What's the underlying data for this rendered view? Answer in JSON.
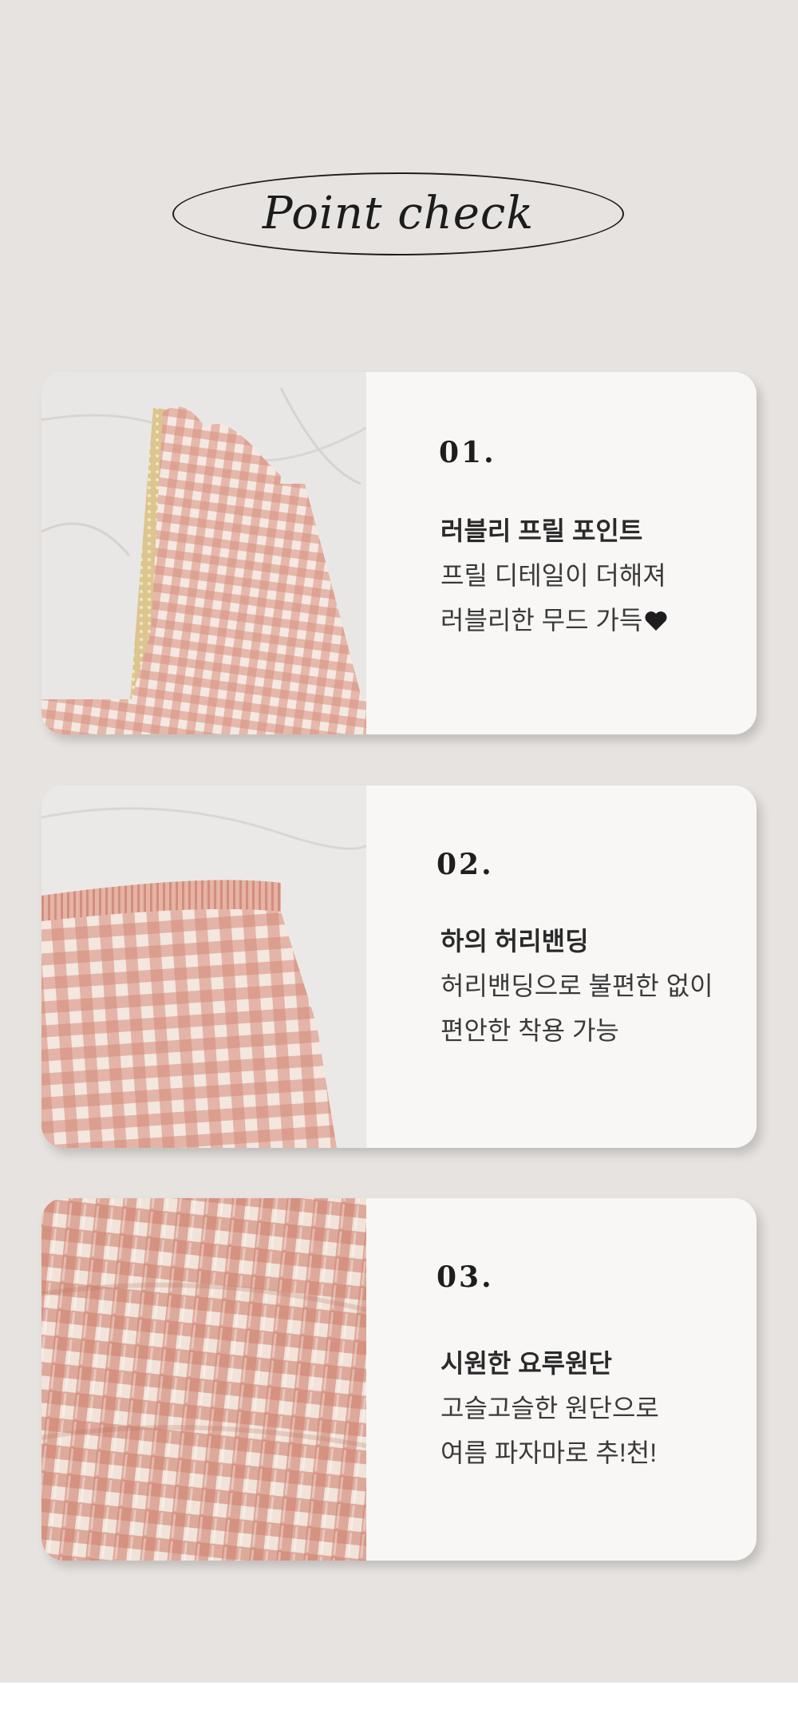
{
  "title": "Point check",
  "points": [
    {
      "number": "01.",
      "heading": "러블리 프릴 포인트",
      "line1": "프릴 디테일이 더해져",
      "line2": "러블리한 무드 가득",
      "icon": "heart-icon"
    },
    {
      "number": "02.",
      "heading": "하의 허리밴딩",
      "line1": "허리밴딩으로 불편한 없이",
      "line2": "편안한 착용 가능"
    },
    {
      "number": "03.",
      "heading": "시원한 요루원단",
      "line1": "고슬고슬한 원단으로",
      "line2": "여름 파자마로 추!천!"
    }
  ],
  "colors": {
    "background": "#e7e3e0",
    "card": "#f8f7f5",
    "gingham": "#d8917f",
    "fabric_white": "#efece8",
    "lace": "#d9c38a",
    "text": "#2b2b2b"
  }
}
